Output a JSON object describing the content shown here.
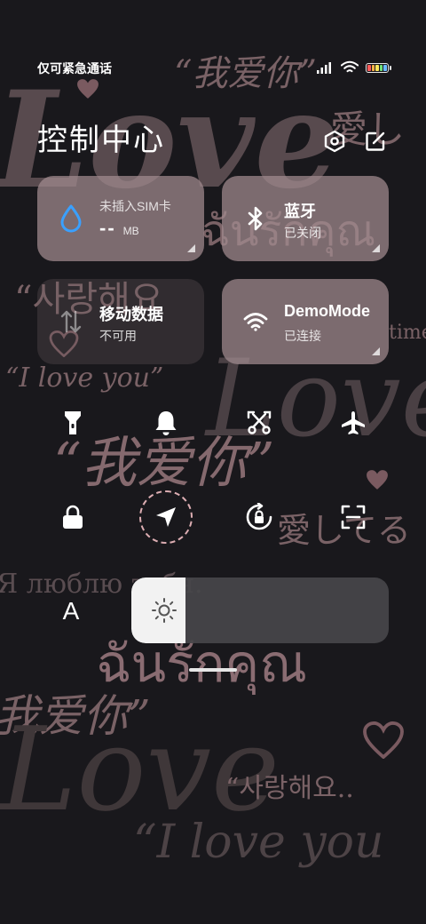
{
  "status_bar": {
    "carrier_text": "仅可紧急通话",
    "signal_icon": "signal-icon",
    "wifi_icon": "wifi-icon",
    "battery_icon": "battery-icon",
    "battery_colors": [
      "#ff5a5a",
      "#ffb347",
      "#ffe45a",
      "#6fe07a",
      "#6ab8ff"
    ]
  },
  "header": {
    "title": "控制中心",
    "settings_icon": "settings-hexagon-icon",
    "edit_icon": "edit-icon"
  },
  "tiles": [
    {
      "id": "data-usage",
      "title": "未插入SIM卡",
      "value": "--",
      "unit": "MB",
      "icon": "water-drop-icon",
      "accent": "#3aa0ff"
    },
    {
      "id": "bluetooth",
      "title": "蓝牙",
      "subtitle": "已关闭",
      "icon": "bluetooth-icon"
    },
    {
      "id": "mobile-data",
      "title": "移动数据",
      "subtitle": "不可用",
      "icon": "mobile-data-arrows-icon"
    },
    {
      "id": "wifi",
      "title": "DemoMode",
      "subtitle": "已连接",
      "icon": "wifi-icon"
    }
  ],
  "toggles_row1": [
    {
      "id": "flashlight",
      "icon": "flashlight-icon"
    },
    {
      "id": "ringer",
      "icon": "bell-icon"
    },
    {
      "id": "screenshot",
      "icon": "scissors-icon"
    },
    {
      "id": "airplane",
      "icon": "airplane-icon"
    }
  ],
  "toggles_row2": [
    {
      "id": "lock",
      "icon": "lock-icon"
    },
    {
      "id": "location",
      "icon": "location-arrow-icon"
    },
    {
      "id": "rotation-lock",
      "icon": "rotation-lock-icon"
    },
    {
      "id": "scanner",
      "icon": "scan-icon"
    }
  ],
  "brightness": {
    "auto_label": "A",
    "level_percent": 21,
    "icon": "sun-icon"
  },
  "wallpaper": {
    "texts": [
      "“我爱你”",
      "Love",
      "愛し",
      "ฉันรักคุณ",
      "“사랑해요",
      "time",
      "“I love you”",
      "Love",
      "“我爱你”",
      "愛してる",
      "Я люблю тебя.",
      "ฉันรักคุณ",
      "我爱你”",
      "Love",
      "“사랑해요..",
      "“I love you"
    ],
    "text_color": "#7a6266"
  }
}
